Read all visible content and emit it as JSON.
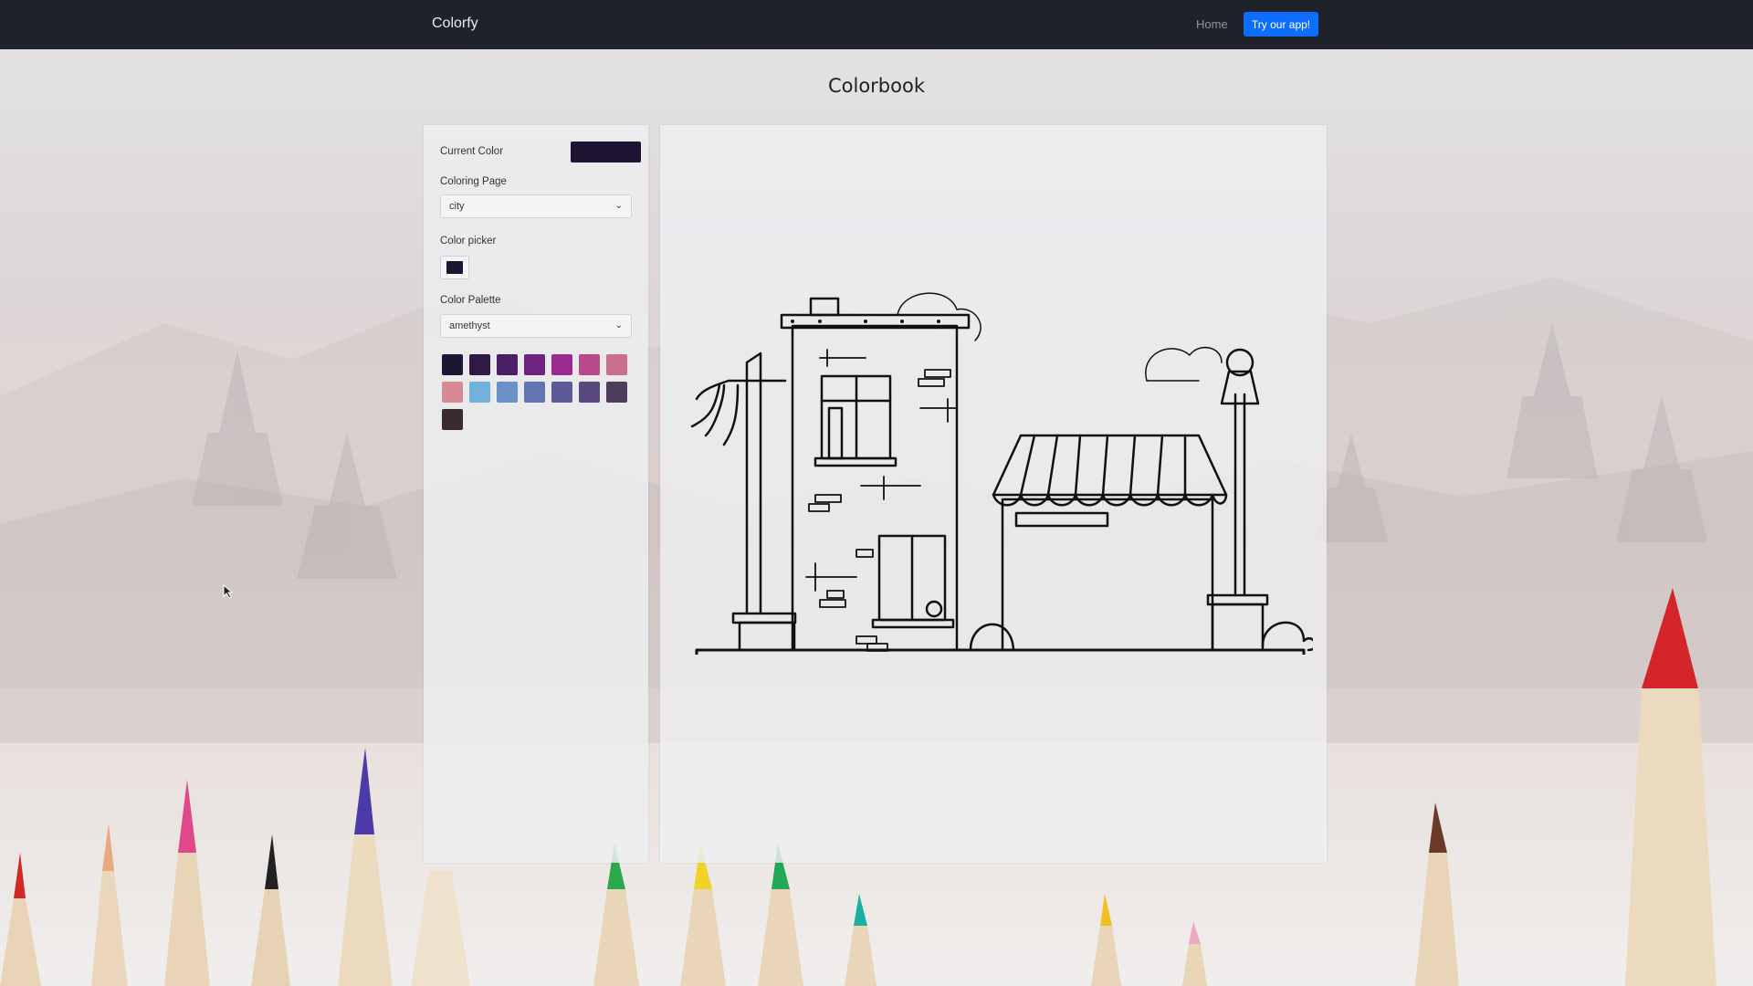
{
  "navbar": {
    "brand": "Colorfy",
    "home_label": "Home",
    "cta_label": "Try our app!"
  },
  "page": {
    "title": "Colorbook"
  },
  "sidebar": {
    "current_color_label": "Current Color",
    "current_color": "#1e1533",
    "coloring_page_label": "Coloring Page",
    "coloring_page_value": "city",
    "color_picker_label": "Color picker",
    "color_picker_value": "#1e1533",
    "color_palette_label": "Color Palette",
    "color_palette_value": "amethyst",
    "palette_swatches": [
      "#1e1533",
      "#2e1a45",
      "#4a1f63",
      "#6f2380",
      "#9b2a8e",
      "#b84a8c",
      "#c9708e",
      "#d88a94",
      "#6fb2dc",
      "#6a90c8",
      "#6474b0",
      "#5e5a98",
      "#584a7e",
      "#4e3c5c",
      "#3b2b30"
    ]
  },
  "colors": {
    "navbar_bg": "#1e232b",
    "cta_bg": "#0d6efd"
  }
}
